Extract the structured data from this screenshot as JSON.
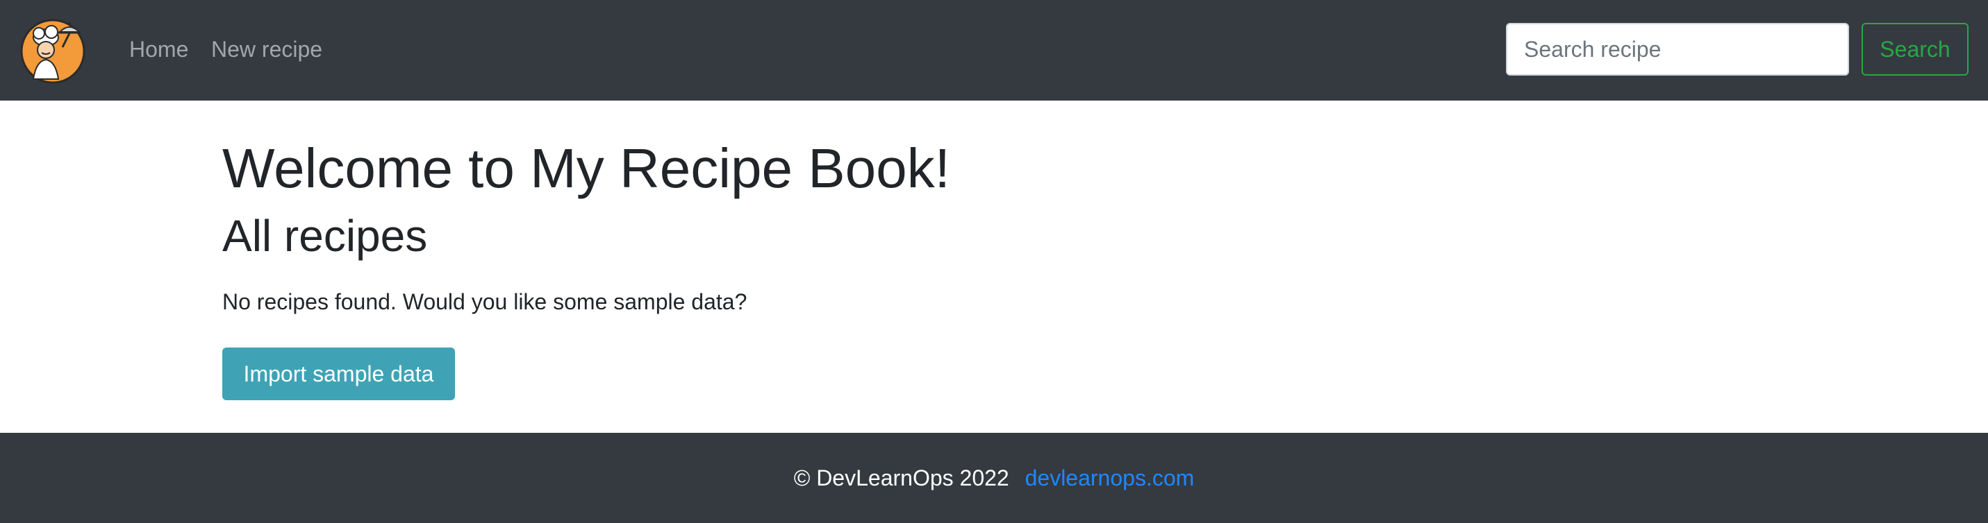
{
  "header": {
    "logo_icon": "chef-holding-cloche-logo",
    "nav": {
      "home_label": "Home",
      "new_recipe_label": "New recipe"
    },
    "search": {
      "placeholder": "Search recipe",
      "value": "",
      "button_label": "Search"
    }
  },
  "main": {
    "title": "Welcome to My Recipe Book!",
    "section_title": "All recipes",
    "empty_message": "No recipes found. Would you like some sample data?",
    "import_button_label": "Import sample data"
  },
  "footer": {
    "copyright": "© DevLearnOps 2022",
    "link_label": "devlearnops.com"
  },
  "colors": {
    "navbar_bg": "#343a40",
    "search_button": "#28a745",
    "import_button": "#3fa3b5",
    "footer_link": "#1e88ff",
    "logo_bg": "#f39a3a"
  }
}
